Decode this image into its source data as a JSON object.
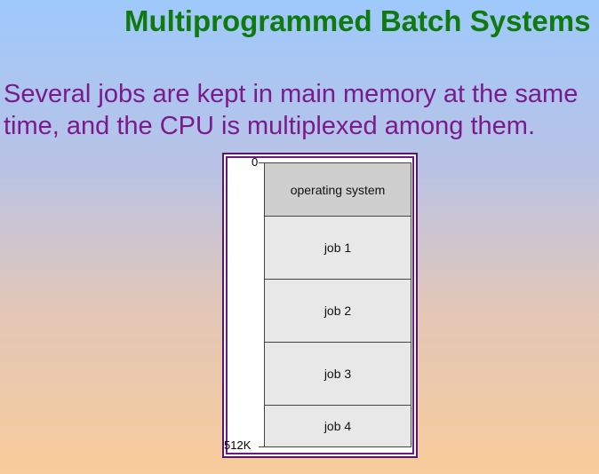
{
  "slide": {
    "title": "Multiprogrammed Batch Systems",
    "body_line1": "Several jobs are kept in main memory at the same",
    "body_line2": "time, and the CPU is multiplexed among them."
  },
  "memory_diagram": {
    "start_address": "0",
    "end_address": "512K",
    "segments": [
      {
        "label": "operating system"
      },
      {
        "label": "job 1"
      },
      {
        "label": "job 2"
      },
      {
        "label": "job 3"
      },
      {
        "label": "job 4"
      }
    ]
  }
}
